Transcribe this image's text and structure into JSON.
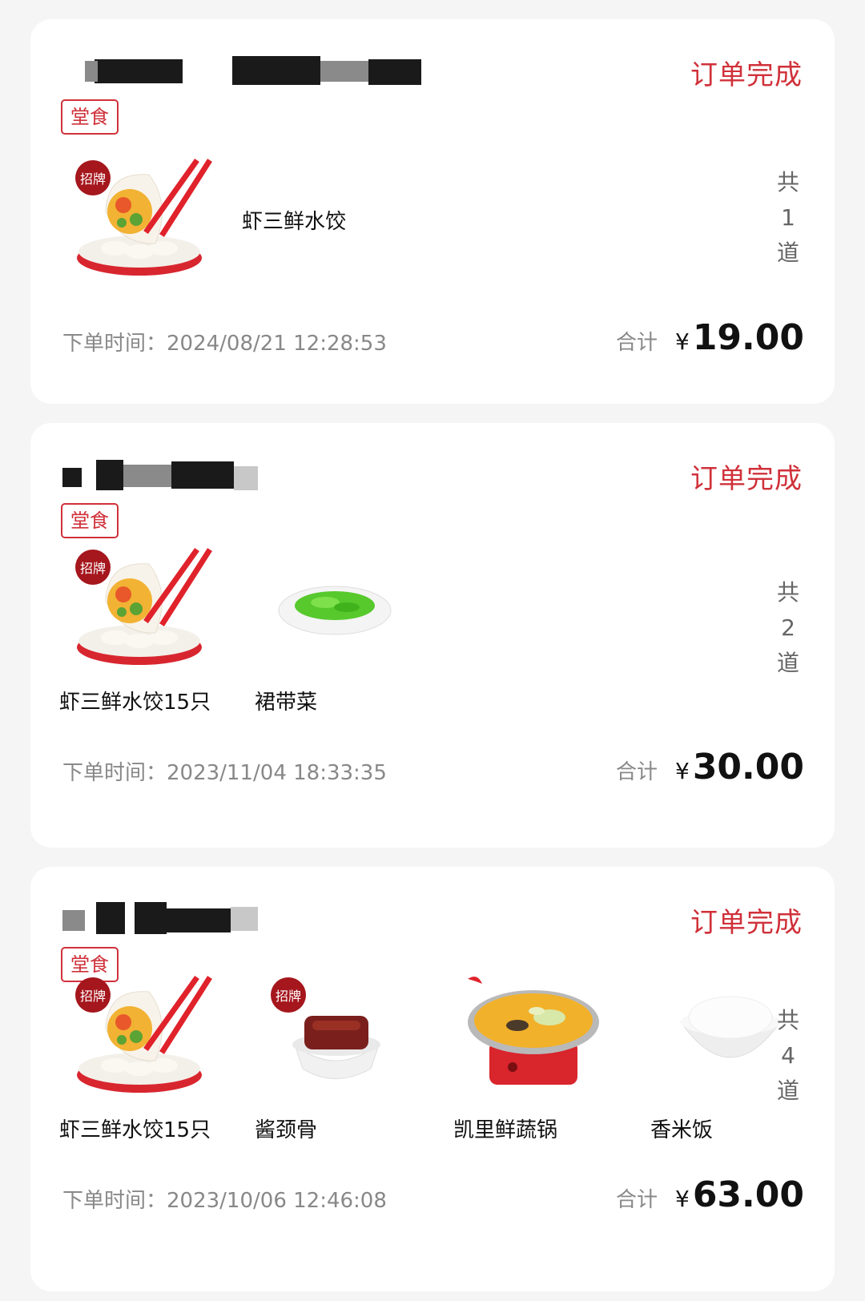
{
  "orders": [
    {
      "status": "订单完成",
      "tag": "堂食",
      "items": [
        {
          "name": "虾三鲜水饺",
          "image": "dumpling-icon"
        }
      ],
      "count": [
        "共",
        "1",
        "道"
      ],
      "order_time": "下单时间：2024/08/21 12:28:53",
      "total_label": "合计",
      "currency": "¥",
      "total": "19.00"
    },
    {
      "status": "订单完成",
      "tag": "堂食",
      "items": [
        {
          "name": "虾三鲜水饺15只",
          "image": "dumpling-icon"
        },
        {
          "name": "裙带菜",
          "image": "seaweed-icon"
        }
      ],
      "count": [
        "共",
        "2",
        "道"
      ],
      "order_time": "下单时间：2023/11/04 18:33:35",
      "total_label": "合计",
      "currency": "¥",
      "total": "30.00"
    },
    {
      "status": "订单完成",
      "tag": "堂食",
      "items": [
        {
          "name": "虾三鲜水饺15只",
          "image": "dumpling-icon"
        },
        {
          "name": "酱颈骨",
          "image": "pork-bone-icon"
        },
        {
          "name": "凯里鲜蔬锅",
          "image": "hotpot-icon"
        },
        {
          "name": "香米饭",
          "image": "rice-bowl-icon"
        }
      ],
      "count": [
        "共",
        "4",
        "道"
      ],
      "order_time": "下单时间：2023/10/06 12:46:08",
      "total_label": "合计",
      "currency": "¥",
      "total": "63.00"
    }
  ],
  "colors": {
    "accent": "#d0313a",
    "muted": "#888888",
    "background": "#f5f5f5"
  }
}
